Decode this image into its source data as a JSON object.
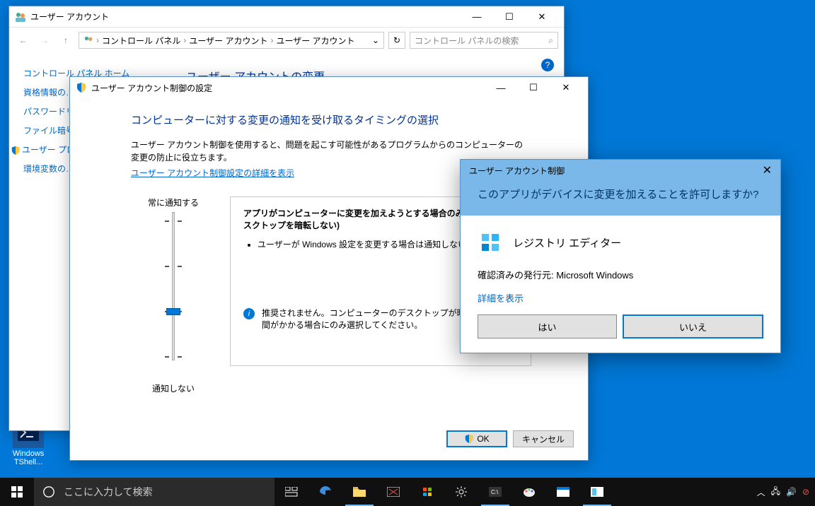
{
  "desktop": {
    "icon_label": "Windows TShell..."
  },
  "win1": {
    "title": "ユーザー アカウント",
    "breadcrumb": [
      "コントロール パネル",
      "ユーザー アカウント",
      "ユーザー アカウント"
    ],
    "search_placeholder": "コントロール パネルの検索",
    "sidebar": {
      "home": "コントロール パネル ホーム",
      "links": [
        "資格情報の…",
        "パスワードリ…",
        "ファイル暗号…",
        "ユーザー プロ…\nィの構成",
        "環境変数の…"
      ]
    },
    "main_heading": "ユーザー アカウントの変更"
  },
  "win2": {
    "title": "ユーザー アカウント制御の設定",
    "heading": "コンピューターに対する変更の通知を受け取るタイミングの選択",
    "desc": "ユーザー アカウント制御を使用すると、問題を起こす可能性があるプログラムからのコンピューターの変更の防止に役立ちます。",
    "link": "ユーザー アカウント制御設定の詳細を表示",
    "slider_top": "常に通知する",
    "slider_bottom": "通知しない",
    "box_title": "アプリがコンピューターに変更を加えようとする場合のみ通知する (デスクトップを暗転しない)",
    "box_bullet": "ユーザーが Windows 設定を変更する場合は通知しない",
    "info_text": "推奨されません。コンピューターのデスクトップが暗転する際に時間がかかる場合にのみ選択してください。",
    "ok": "OK",
    "cancel": "キャンセル"
  },
  "uac": {
    "title": "ユーザー アカウント制御",
    "question": "このアプリがデバイスに変更を加えることを許可しますか?",
    "app_name": "レジストリ エディター",
    "publisher": "確認済みの発行元: Microsoft Windows",
    "details": "詳細を表示",
    "yes": "はい",
    "no": "いいえ"
  },
  "taskbar": {
    "search": "ここに入力して検索"
  }
}
